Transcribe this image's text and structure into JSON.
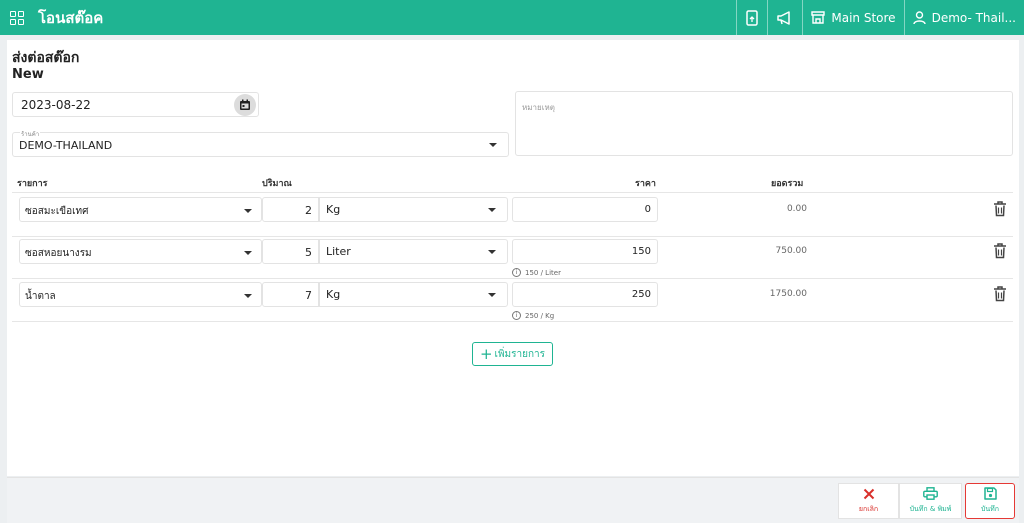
{
  "app": {
    "title": "โอนสต๊อค"
  },
  "topbar": {
    "store_label": "Main Store",
    "user_label": "Demo- Thail..."
  },
  "page": {
    "heading": "ส่งต่อสต๊อก",
    "status": "New"
  },
  "form": {
    "date": "2023-08-22",
    "store_label": "ร้านค้า",
    "store_value": "DEMO-THAILAND",
    "note_placeholder": "หมายเหตุ"
  },
  "table": {
    "headers": {
      "item": "รายการ",
      "qty": "ปริมาณ",
      "price": "ราคา",
      "total": "ยอดรวม"
    },
    "rows": [
      {
        "item": "ซอสมะเขือเทศ",
        "qty": "2",
        "unit": "Kg",
        "price": "0",
        "total": "0.00",
        "hint": ""
      },
      {
        "item": "ซอสหอยนางรม",
        "qty": "5",
        "unit": "Liter",
        "price": "150",
        "total": "750.00",
        "hint": "150 / Liter"
      },
      {
        "item": "น้ำตาล",
        "qty": "7",
        "unit": "Kg",
        "price": "250",
        "total": "1750.00",
        "hint": "250 / Kg"
      }
    ]
  },
  "add_item_label": "เพิ่มรายการ",
  "footer": {
    "cancel_label": "ยกเลิก",
    "save_print_label": "บันทึก & พิมพ์",
    "save_label": "บันทึก"
  },
  "colors": {
    "brand": "#1fb492",
    "danger": "#d9302b",
    "highlight": "#e53935"
  }
}
